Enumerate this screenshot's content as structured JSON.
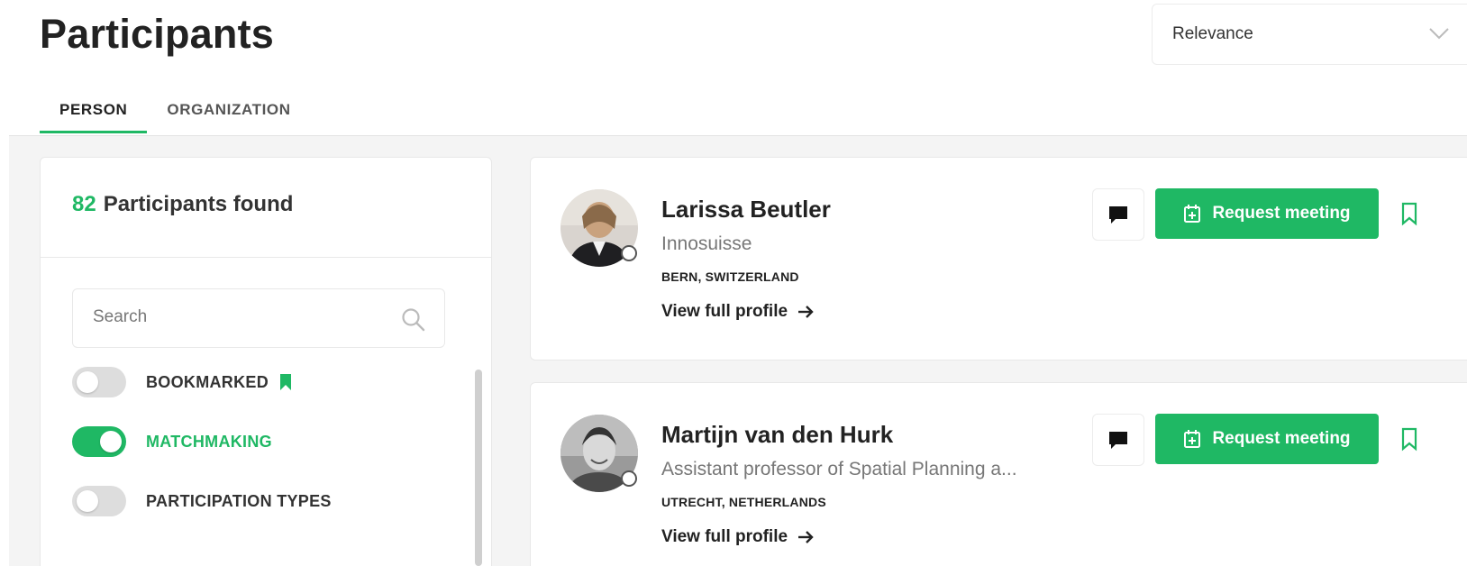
{
  "header": {
    "title": "Participants",
    "sort_value": "Relevance"
  },
  "tabs": [
    {
      "label": "PERSON",
      "active": true
    },
    {
      "label": "ORGANIZATION",
      "active": false
    }
  ],
  "sidebar": {
    "found_count": "82",
    "found_label": "Participants found",
    "search_placeholder": "Search",
    "filters": [
      {
        "label": "BOOKMARKED",
        "on": false,
        "icon": "bookmark-icon"
      },
      {
        "label": "MATCHMAKING",
        "on": true
      },
      {
        "label": "PARTICIPATION TYPES",
        "on": false
      }
    ]
  },
  "participants": [
    {
      "name": "Larissa Beutler",
      "organization": "Innosuisse",
      "location": "BERN, SWITZERLAND",
      "profile_link": "View full profile",
      "request_label": "Request meeting"
    },
    {
      "name": "Martijn van den Hurk",
      "organization": "Assistant professor of Spatial Planning a...",
      "location": "UTRECHT, NETHERLANDS",
      "profile_link": "View full profile",
      "request_label": "Request meeting"
    }
  ],
  "colors": {
    "accent": "#1fb864",
    "background": "#f4f4f4"
  }
}
